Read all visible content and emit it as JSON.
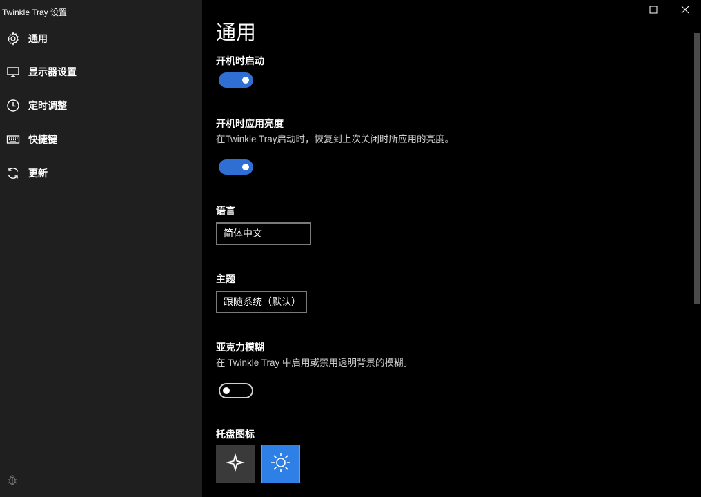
{
  "window": {
    "title": "Twinkle Tray 设置"
  },
  "sidebar": {
    "items": [
      {
        "label": "通用",
        "icon": "gear-icon"
      },
      {
        "label": "显示器设置",
        "icon": "monitor-icon"
      },
      {
        "label": "定时调整",
        "icon": "clock-icon"
      },
      {
        "label": "快捷键",
        "icon": "keyboard-icon"
      },
      {
        "label": "更新",
        "icon": "refresh-icon"
      }
    ],
    "footer_icon": "bug-icon"
  },
  "main": {
    "title": "通用",
    "startup": {
      "label": "开机时启动",
      "enabled": true
    },
    "apply_brightness": {
      "label": "开机时应用亮度",
      "description": "在Twinkle Tray启动时，恢复到上次关闭时所应用的亮度。",
      "enabled": true
    },
    "language": {
      "label": "语言",
      "value": "简体中文"
    },
    "theme": {
      "label": "主题",
      "value": "跟随系统（默认）"
    },
    "acrylic": {
      "label": "亚克力模糊",
      "description": "在 Twinkle Tray 中启用或禁用透明背景的模糊。",
      "enabled": false
    },
    "tray_icon": {
      "label": "托盘图标",
      "options": [
        "sparkle-icon",
        "sun-icon"
      ],
      "selected": 1
    }
  },
  "colors": {
    "accent": "#2f6fd3",
    "tray_selected": "#2e7fe6",
    "tray_default": "#3a3a3a"
  }
}
